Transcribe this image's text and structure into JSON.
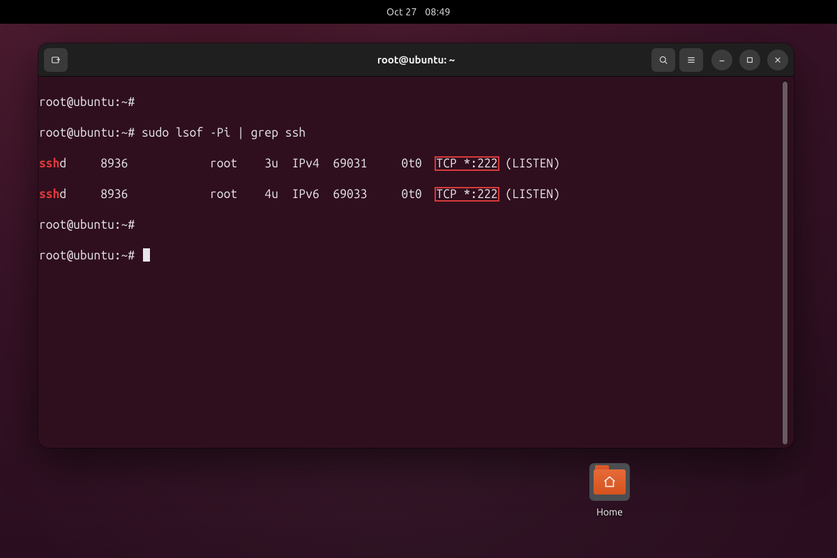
{
  "topbar": {
    "date": "Oct 27",
    "time": "08:49"
  },
  "terminal": {
    "title": "root@ubuntu: ~",
    "prompt": "root@ubuntu:~#",
    "lines": {
      "l1": "root@ubuntu:~#",
      "l2_prompt": "root@ubuntu:~# ",
      "l2_cmd": "sudo lsof -Pi | grep ssh",
      "l3_hl": "ssh",
      "l3_rest_a": "d     8936            root    3u  IPv4  69031     0t0  ",
      "l3_box": "TCP *:222",
      "l3_rest_b": " (LISTEN)",
      "l4_hl": "ssh",
      "l4_rest_a": "d     8936            root    4u  IPv6  69033     0t0  ",
      "l4_box": "TCP *:222",
      "l4_rest_b": " (LISTEN)",
      "l5": "root@ubuntu:~#",
      "l6": "root@ubuntu:~# "
    }
  },
  "desktop": {
    "home_label": "Home"
  },
  "icons": {
    "new_tab": "new-tab-icon",
    "search": "search-icon",
    "menu": "hamburger-icon",
    "minimize": "minimize-icon",
    "maximize": "maximize-icon",
    "close": "close-icon",
    "home_folder": "home-folder-icon"
  },
  "colors": {
    "highlight_red": "#e03a3a",
    "annotation_box": "#d73a3a",
    "terminal_bg": "#2f0f1e",
    "titlebar_bg": "#1f1f1f"
  }
}
